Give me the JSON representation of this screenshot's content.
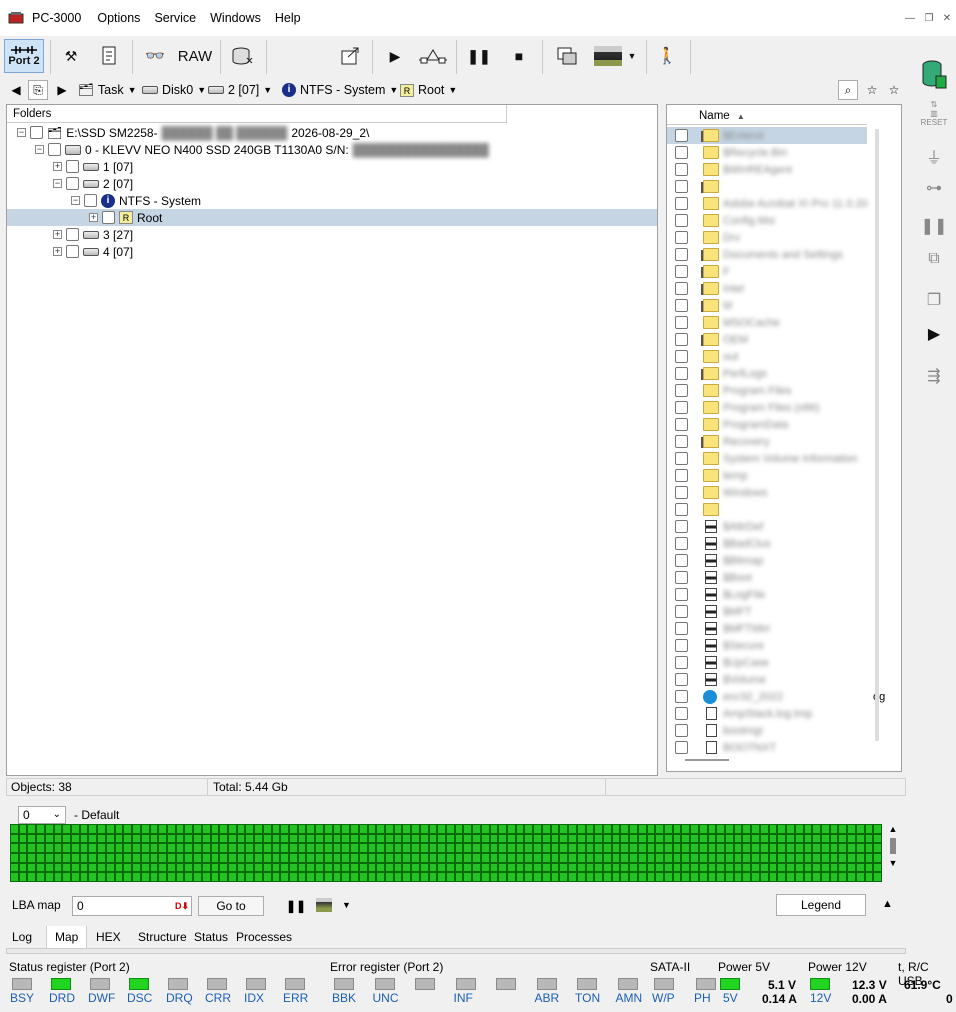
{
  "app": {
    "title": "PC-3000",
    "menu": [
      "Options",
      "Service",
      "Windows",
      "Help"
    ]
  },
  "toolbar": {
    "port_label": "Port 2",
    "raw_label": "RAW"
  },
  "nav": {
    "task": "Task",
    "disk": "Disk0",
    "partition": "2 [07]",
    "fs": "NTFS - System",
    "root": "Root"
  },
  "folders_panel": {
    "header": "Folders",
    "tree": [
      {
        "label": "E:\\SSD SM2258-",
        "suffix": "2026-08-29_2\\"
      },
      {
        "label": "0 - KLEVV NEO N400 SSD 240GB T1130A0 S/N:"
      },
      {
        "label": "1 [07]"
      },
      {
        "label": "2 [07]"
      },
      {
        "label": "NTFS - System"
      },
      {
        "label": "Root"
      },
      {
        "label": "3 [27]"
      },
      {
        "label": "4 [07]"
      }
    ]
  },
  "files_panel": {
    "header": "Name",
    "rows": [
      {
        "type": "special-folder",
        "name": "$Extend"
      },
      {
        "type": "folder",
        "name": "$Recycle.Bin"
      },
      {
        "type": "folder",
        "name": "$WinREAgent"
      },
      {
        "type": "special-folder",
        "name": ""
      },
      {
        "type": "folder",
        "name": "Adobe Acrobat XI Pro 11.0.20"
      },
      {
        "type": "folder",
        "name": "Config.Msi"
      },
      {
        "type": "folder",
        "name": "Drv"
      },
      {
        "type": "special-folder",
        "name": "Documents and Settings"
      },
      {
        "type": "special-folder",
        "name": "F"
      },
      {
        "type": "special-folder",
        "name": "Intel"
      },
      {
        "type": "special-folder",
        "name": "M"
      },
      {
        "type": "folder",
        "name": "MSOCache"
      },
      {
        "type": "special-folder",
        "name": "OEM"
      },
      {
        "type": "folder",
        "name": "out"
      },
      {
        "type": "special-folder",
        "name": "PerfLogs"
      },
      {
        "type": "folder",
        "name": "Program Files"
      },
      {
        "type": "folder",
        "name": "Program Files (x86)"
      },
      {
        "type": "folder",
        "name": "ProgramData"
      },
      {
        "type": "special-folder",
        "name": "Recovery"
      },
      {
        "type": "folder",
        "name": "System Volume Information"
      },
      {
        "type": "folder",
        "name": "temp"
      },
      {
        "type": "folder",
        "name": "Windows"
      },
      {
        "type": "folder",
        "name": ""
      },
      {
        "type": "sys",
        "name": "$AttrDef"
      },
      {
        "type": "special-sys",
        "name": "$BadClus"
      },
      {
        "type": "sys",
        "name": "$Bitmap"
      },
      {
        "type": "sys",
        "name": "$Boot"
      },
      {
        "type": "sys",
        "name": "$LogFile"
      },
      {
        "type": "sys",
        "name": "$MFT"
      },
      {
        "type": "sys",
        "name": "$MFTMirr"
      },
      {
        "type": "sys",
        "name": "$Secure"
      },
      {
        "type": "sys",
        "name": "$UpCase"
      },
      {
        "type": "special-sys",
        "name": "$Volume"
      },
      {
        "type": "edge",
        "name": "ecc32_2022",
        "visible_tail": "og"
      },
      {
        "type": "doc",
        "name": "AmpStack.log.tmp"
      },
      {
        "type": "link",
        "name": "bootmgr"
      },
      {
        "type": "link",
        "name": "BOOTNXT"
      }
    ]
  },
  "status": {
    "objects": "Objects: 38",
    "total": "Total: 5.44 Gb"
  },
  "map": {
    "select_value": "0",
    "preset": "- Default",
    "lba_label": "LBA map",
    "lba_value": "0",
    "goto_label": "Go to",
    "legend_label": "Legend",
    "cells_cols": 100,
    "cells_rows": 6
  },
  "bottom_tabs": [
    "Log",
    "Map",
    "HEX",
    "Structure",
    "Status",
    "Processes"
  ],
  "registers": {
    "status_title": "Status register (Port 2)",
    "status_bits": [
      {
        "label": "BSY",
        "on": false
      },
      {
        "label": "DRD",
        "on": true
      },
      {
        "label": "DWF",
        "on": false
      },
      {
        "label": "DSC",
        "on": true
      },
      {
        "label": "DRQ",
        "on": false
      },
      {
        "label": "CRR",
        "on": false
      },
      {
        "label": "IDX",
        "on": false
      },
      {
        "label": "ERR",
        "on": false
      }
    ],
    "error_title": "Error register (Port 2)",
    "error_bits": [
      {
        "label": "BBK",
        "on": false
      },
      {
        "label": "UNC",
        "on": false
      },
      {
        "label": "",
        "on": false
      },
      {
        "label": "INF",
        "on": false
      },
      {
        "label": "",
        "on": false
      },
      {
        "label": "ABR",
        "on": false
      },
      {
        "label": "TON",
        "on": false
      },
      {
        "label": "AMN",
        "on": false
      }
    ],
    "sata_title": "SATA-II",
    "sata_bits": [
      {
        "label": "W/P",
        "on": false
      },
      {
        "label": "PH",
        "on": false
      }
    ],
    "power5_title": "Power 5V",
    "power5_led": "5V",
    "power5_v": "5.1 V",
    "power5_a": "0.14 A",
    "power12_title": "Power 12V",
    "power12_led": "12V",
    "power12_v": "12.3 V",
    "power12_a": "0.00 A",
    "temp_title": "t, R/C USB",
    "temp_val": "61.9°C",
    "temp_sub": "0"
  },
  "colors": {
    "led_on": "#21d421",
    "led_off": "#b8b8b8",
    "map_cell": "#22c322",
    "selection": "#c5d5e4",
    "label_blue": "#1a5fb4"
  }
}
